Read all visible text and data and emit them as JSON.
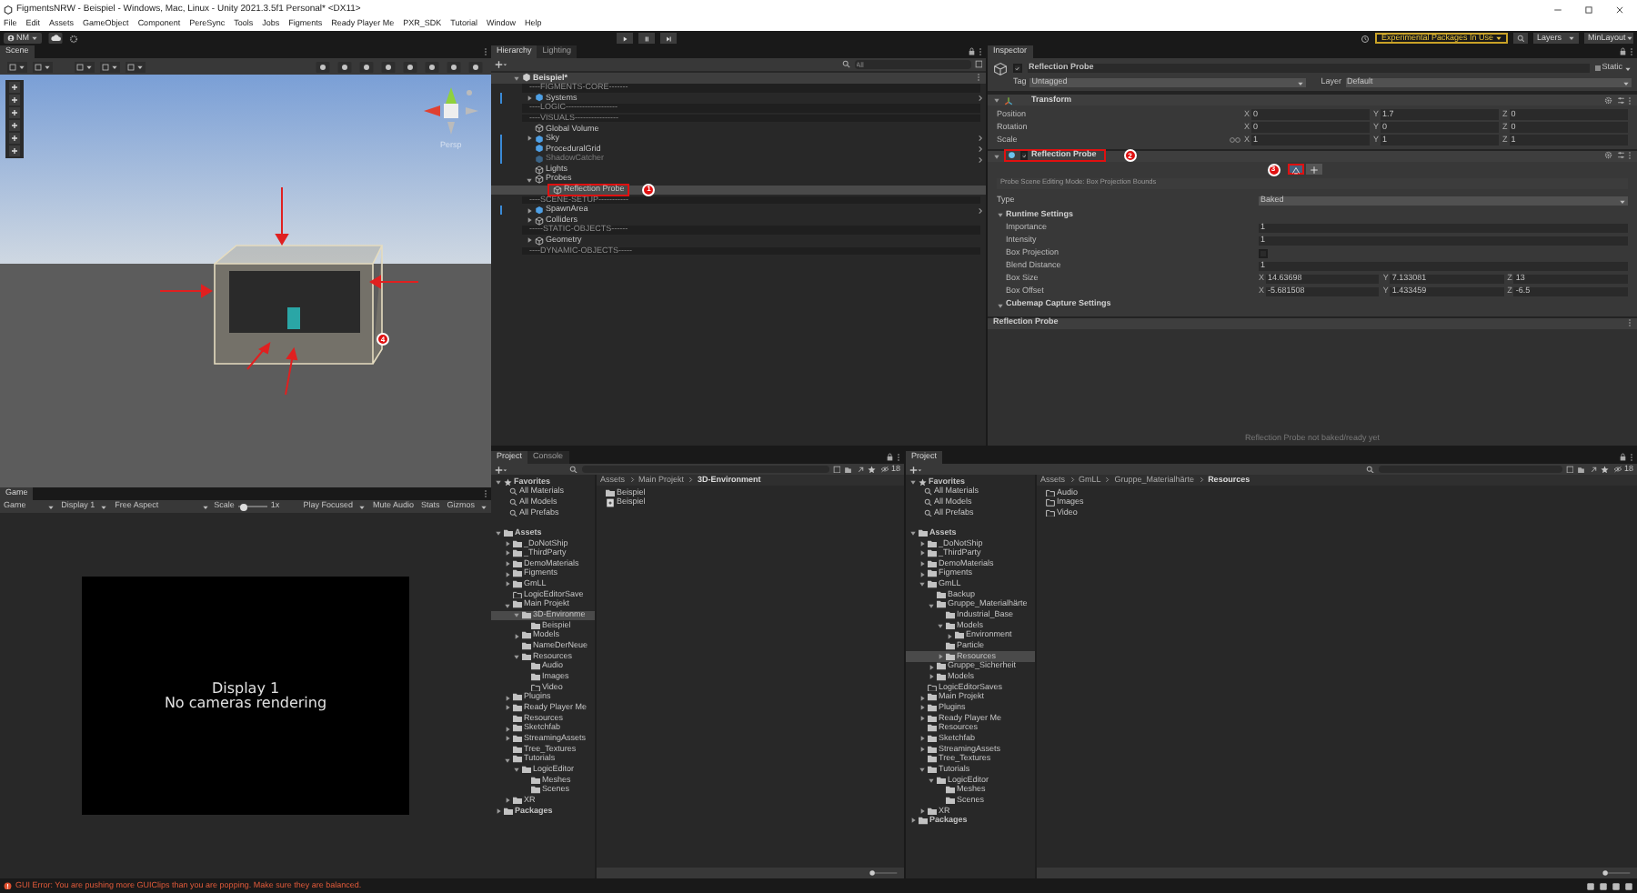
{
  "window": {
    "title": "FigmentsNRW - Beispiel - Windows, Mac, Linux - Unity 2021.3.5f1 Personal* <DX11>"
  },
  "menu": [
    "File",
    "Edit",
    "Assets",
    "GameObject",
    "Component",
    "PereSync",
    "Tools",
    "Jobs",
    "Figments",
    "Ready Player Me",
    "PXR_SDK",
    "Tutorial",
    "Window",
    "Help"
  ],
  "toolbar": {
    "account": "NM",
    "experimental": "Experimental Packages In Use",
    "layers": "Layers",
    "layout": "MinLayout"
  },
  "scene": {
    "tab": "Scene",
    "persp_label": "Persp",
    "marker": "4"
  },
  "game": {
    "tab": "Game",
    "controls": [
      {
        "kind": "dropdown",
        "label": "Game"
      },
      {
        "kind": "dropdown",
        "label": "Display 1"
      },
      {
        "kind": "dropdown",
        "label": "Free Aspect"
      },
      {
        "kind": "slider",
        "label": "Scale",
        "level": 0.1,
        "reading": "1x"
      },
      {
        "kind": "dropdown",
        "label": "Play Focused"
      },
      {
        "kind": "toggle",
        "label": "Mute Audio",
        "on": false
      },
      {
        "kind": "toggle",
        "label": "Stats",
        "on": false
      },
      {
        "kind": "dropdown",
        "label": "Gizmos"
      }
    ],
    "screen_lines": [
      "Display 1",
      "No cameras rendering"
    ]
  },
  "hierarchy": {
    "tabs": [
      {
        "label": "Hierarchy",
        "selected": true
      },
      {
        "label": "Lighting",
        "selected": false
      }
    ],
    "search": {
      "placeholder": "All"
    },
    "scene": {
      "label": "Beispiel*",
      "expanded": true,
      "children": [
        {
          "kind": "separator",
          "label": "----FIGMENTS-CORE-------"
        },
        {
          "kind": "object",
          "label": "Systems",
          "prefab": true,
          "disabled": false,
          "selected": false,
          "expanded": false
        },
        {
          "kind": "separator",
          "label": "----LOGIC-------------------"
        },
        {
          "kind": "separator",
          "label": "----VISUALS----------------"
        },
        {
          "kind": "object",
          "label": "Global Volume",
          "prefab": false,
          "disabled": false,
          "selected": false
        },
        {
          "kind": "object",
          "label": "Sky",
          "prefab": true,
          "disabled": false,
          "selected": false,
          "expanded": false
        },
        {
          "kind": "object",
          "label": "ProceduralGrid",
          "prefab": true,
          "disabled": false,
          "selected": false
        },
        {
          "kind": "object",
          "label": "ShadowCatcher",
          "prefab": true,
          "disabled": true,
          "selected": false
        },
        {
          "kind": "object",
          "label": "Lights",
          "prefab": false,
          "disabled": false,
          "selected": false
        },
        {
          "kind": "object",
          "label": "Probes",
          "prefab": false,
          "disabled": false,
          "selected": false,
          "expanded": true,
          "children": [
            {
              "kind": "object",
              "label": "Reflection Probe",
              "prefab": false,
              "disabled": false,
              "selected": true,
              "marker": "1"
            }
          ]
        },
        {
          "kind": "separator",
          "label": "----SCENE-SETUP-----------"
        },
        {
          "kind": "object",
          "label": "SpawnArea",
          "prefab": true,
          "disabled": false,
          "selected": false,
          "expanded": false
        },
        {
          "kind": "object",
          "label": "Colliders",
          "prefab": false,
          "disabled": false,
          "selected": false,
          "expanded": false
        },
        {
          "kind": "separator",
          "label": "-----STATIC-OBJECTS------"
        },
        {
          "kind": "object",
          "label": "Geometry",
          "prefab": false,
          "disabled": false,
          "selected": false,
          "expanded": false
        },
        {
          "kind": "separator",
          "label": "----DYNAMIC-OBJECTS-----"
        }
      ]
    }
  },
  "inspector": {
    "tab": "Inspector",
    "object": {
      "active": true,
      "name": "Reflection Probe",
      "static_label": "Static",
      "tag_label": "Tag",
      "tag": "Untagged",
      "layer_label": "Layer",
      "layer": "Default"
    },
    "transform": {
      "title": "Transform",
      "expanded": true,
      "rows": [
        {
          "label": "Position",
          "values": [
            {
              "axis": "X",
              "value": "0"
            },
            {
              "axis": "Y",
              "value": "1.7"
            },
            {
              "axis": "Z",
              "value": "0"
            }
          ]
        },
        {
          "label": "Rotation",
          "values": [
            {
              "axis": "X",
              "value": "0"
            },
            {
              "axis": "Y",
              "value": "0"
            },
            {
              "axis": "Z",
              "value": "0"
            }
          ]
        },
        {
          "label": "Scale",
          "linked": true,
          "values": [
            {
              "axis": "X",
              "value": "1"
            },
            {
              "axis": "Y",
              "value": "1"
            },
            {
              "axis": "Z",
              "value": "1"
            }
          ]
        }
      ]
    },
    "probe": {
      "title": "Reflection Probe",
      "enabled": true,
      "expanded": true,
      "marker": "2",
      "edit_modes": [
        {
          "selected": true,
          "marker": "3"
        },
        {
          "selected": false
        }
      ],
      "edit_mode_text": "Probe Scene Editing Mode: Box Projection Bounds",
      "type_label": "Type",
      "type": "Baked",
      "sections": [
        {
          "title": "Runtime Settings",
          "expanded": true,
          "rows": [
            {
              "kind": "value",
              "label": "Importance",
              "value": "1"
            },
            {
              "kind": "value",
              "label": "Intensity",
              "value": "1"
            },
            {
              "kind": "checkbox",
              "label": "Box Projection",
              "checked": false
            },
            {
              "kind": "value",
              "label": "Blend Distance",
              "value": "1"
            },
            {
              "kind": "vector",
              "label": "Box Size",
              "values": [
                {
                  "axis": "X",
                  "value": "14.63698"
                },
                {
                  "axis": "Y",
                  "value": "7.133081"
                },
                {
                  "axis": "Z",
                  "value": "13"
                }
              ]
            },
            {
              "kind": "vector",
              "label": "Box Offset",
              "values": [
                {
                  "axis": "X",
                  "value": "-5.681508"
                },
                {
                  "axis": "Y",
                  "value": "1.433459"
                },
                {
                  "axis": "Z",
                  "value": "-6.5"
                }
              ]
            }
          ]
        },
        {
          "title": "Cubemap Capture Settings",
          "expanded": true
        }
      ]
    },
    "preview": {
      "title": "Reflection Probe",
      "message": "Reflection Probe not baked/ready yet"
    }
  },
  "projects": [
    {
      "tabs": [
        {
          "label": "Project",
          "selected": true
        },
        {
          "label": "Console",
          "selected": false
        }
      ],
      "hidden_count": "18",
      "favorites": {
        "label": "Favorites",
        "expanded": true,
        "items": [
          "All Materials",
          "All Models",
          "All Prefabs"
        ]
      },
      "tree": [
        {
          "label": "Assets",
          "kind": "folder",
          "selected": false,
          "expanded": true,
          "children": [
            {
              "label": "_DoNotShip",
              "kind": "folder",
              "selected": false,
              "expanded": false
            },
            {
              "label": "_ThirdParty",
              "kind": "folder",
              "selected": false,
              "expanded": false
            },
            {
              "label": "DemoMaterials",
              "kind": "folder",
              "selected": false,
              "expanded": false
            },
            {
              "label": "Figments",
              "kind": "folder",
              "selected": false,
              "expanded": false
            },
            {
              "label": "GmLL",
              "kind": "folder",
              "selected": false,
              "expanded": false
            },
            {
              "label": "LogicEditorSave",
              "kind": "empty_folder",
              "selected": false
            },
            {
              "label": "Main Projekt",
              "kind": "folder",
              "selected": false,
              "expanded": true,
              "children": [
                {
                  "label": "3D-Environme",
                  "kind": "folder",
                  "selected": true,
                  "expanded": true,
                  "children": [
                    {
                      "label": "Beispiel",
                      "kind": "folder",
                      "selected": false
                    }
                  ]
                },
                {
                  "label": "Models",
                  "kind": "folder",
                  "selected": false,
                  "expanded": false
                },
                {
                  "label": "NameDerNeue",
                  "kind": "folder",
                  "selected": false
                },
                {
                  "label": "Resources",
                  "kind": "folder",
                  "selected": false,
                  "expanded": true,
                  "children": [
                    {
                      "label": "Audio",
                      "kind": "folder",
                      "selected": false
                    },
                    {
                      "label": "Images",
                      "kind": "folder",
                      "selected": false
                    },
                    {
                      "label": "Video",
                      "kind": "empty_folder",
                      "selected": false
                    }
                  ]
                }
              ]
            },
            {
              "label": "Plugins",
              "kind": "folder",
              "selected": false,
              "expanded": false
            },
            {
              "label": "Ready Player Me",
              "kind": "folder",
              "selected": false,
              "expanded": false
            },
            {
              "label": "Resources",
              "kind": "folder",
              "selected": false
            },
            {
              "label": "Sketchfab",
              "kind": "folder",
              "selected": false,
              "expanded": false
            },
            {
              "label": "StreamingAssets",
              "kind": "folder",
              "selected": false,
              "expanded": false
            },
            {
              "label": "Tree_Textures",
              "kind": "folder",
              "selected": false
            },
            {
              "label": "Tutorials",
              "kind": "folder",
              "selected": false,
              "expanded": true,
              "children": [
                {
                  "label": "LogicEditor",
                  "kind": "folder",
                  "selected": false,
                  "expanded": true,
                  "children": [
                    {
                      "label": "Meshes",
                      "kind": "folder",
                      "selected": false
                    },
                    {
                      "label": "Scenes",
                      "kind": "folder",
                      "selected": false
                    }
                  ]
                }
              ]
            },
            {
              "label": "XR",
              "kind": "folder",
              "selected": false,
              "expanded": false
            }
          ]
        },
        {
          "label": "Packages",
          "kind": "folder",
          "selected": false,
          "expanded": false
        }
      ],
      "breadcrumb": [
        "Assets",
        "Main Projekt",
        "3D-Environment"
      ],
      "items": [
        {
          "kind": "folder",
          "label": "Beispiel"
        },
        {
          "kind": "scene",
          "label": "Beispiel"
        }
      ]
    },
    {
      "tabs": [
        {
          "label": "Project",
          "selected": true
        }
      ],
      "hidden_count": "18",
      "favorites": {
        "label": "Favorites",
        "expanded": true,
        "items": [
          "All Materials",
          "All Models",
          "All Prefabs"
        ]
      },
      "tree": [
        {
          "label": "Assets",
          "kind": "folder",
          "selected": false,
          "expanded": true,
          "children": [
            {
              "label": "_DoNotShip",
              "kind": "folder",
              "selected": false,
              "expanded": false
            },
            {
              "label": "_ThirdParty",
              "kind": "folder",
              "selected": false,
              "expanded": false
            },
            {
              "label": "DemoMaterials",
              "kind": "folder",
              "selected": false,
              "expanded": false
            },
            {
              "label": "Figments",
              "kind": "folder",
              "selected": false,
              "expanded": false
            },
            {
              "label": "GmLL",
              "kind": "folder",
              "selected": false,
              "expanded": true,
              "children": [
                {
                  "label": "Backup",
                  "kind": "folder",
                  "selected": false
                },
                {
                  "label": "Gruppe_Materialhärte",
                  "kind": "folder",
                  "selected": false,
                  "expanded": true,
                  "children": [
                    {
                      "label": "Industrial_Base",
                      "kind": "folder",
                      "selected": false
                    },
                    {
                      "label": "Models",
                      "kind": "folder",
                      "selected": false,
                      "expanded": true,
                      "children": [
                        {
                          "label": "Environment",
                          "kind": "folder",
                          "selected": false,
                          "expanded": false
                        }
                      ]
                    },
                    {
                      "label": "Particle",
                      "kind": "folder",
                      "selected": false
                    },
                    {
                      "label": "Resources",
                      "kind": "folder",
                      "selected": true,
                      "expanded": false
                    }
                  ]
                },
                {
                  "label": "Gruppe_Sicherheit",
                  "kind": "folder",
                  "selected": false,
                  "expanded": false
                },
                {
                  "label": "Models",
                  "kind": "folder",
                  "selected": false,
                  "expanded": false
                }
              ]
            },
            {
              "label": "LogicEditorSaves",
              "kind": "empty_folder",
              "selected": false
            },
            {
              "label": "Main Projekt",
              "kind": "folder",
              "selected": false,
              "expanded": false
            },
            {
              "label": "Plugins",
              "kind": "folder",
              "selected": false,
              "expanded": false
            },
            {
              "label": "Ready Player Me",
              "kind": "folder",
              "selected": false,
              "expanded": false
            },
            {
              "label": "Resources",
              "kind": "folder",
              "selected": false
            },
            {
              "label": "Sketchfab",
              "kind": "folder",
              "selected": false,
              "expanded": false
            },
            {
              "label": "StreamingAssets",
              "kind": "folder",
              "selected": false,
              "expanded": false
            },
            {
              "label": "Tree_Textures",
              "kind": "folder",
              "selected": false
            },
            {
              "label": "Tutorials",
              "kind": "folder",
              "selected": false,
              "expanded": true,
              "children": [
                {
                  "label": "LogicEditor",
                  "kind": "folder",
                  "selected": false,
                  "expanded": true,
                  "children": [
                    {
                      "label": "Meshes",
                      "kind": "folder",
                      "selected": false
                    },
                    {
                      "label": "Scenes",
                      "kind": "folder",
                      "selected": false
                    }
                  ]
                }
              ]
            },
            {
              "label": "XR",
              "kind": "folder",
              "selected": false,
              "expanded": false
            }
          ]
        },
        {
          "label": "Packages",
          "kind": "folder",
          "selected": false,
          "expanded": false
        }
      ],
      "breadcrumb": [
        "Assets",
        "GmLL",
        "Gruppe_Materialhärte",
        "Resources"
      ],
      "items": [
        {
          "kind": "empty_folder",
          "label": "Audio"
        },
        {
          "kind": "empty_folder",
          "label": "Images"
        },
        {
          "kind": "empty_folder",
          "label": "Video"
        }
      ]
    }
  ],
  "status_bar": {
    "message": "GUI Error: You are pushing more GUIClips than you are popping. Make sure they are balanced."
  }
}
